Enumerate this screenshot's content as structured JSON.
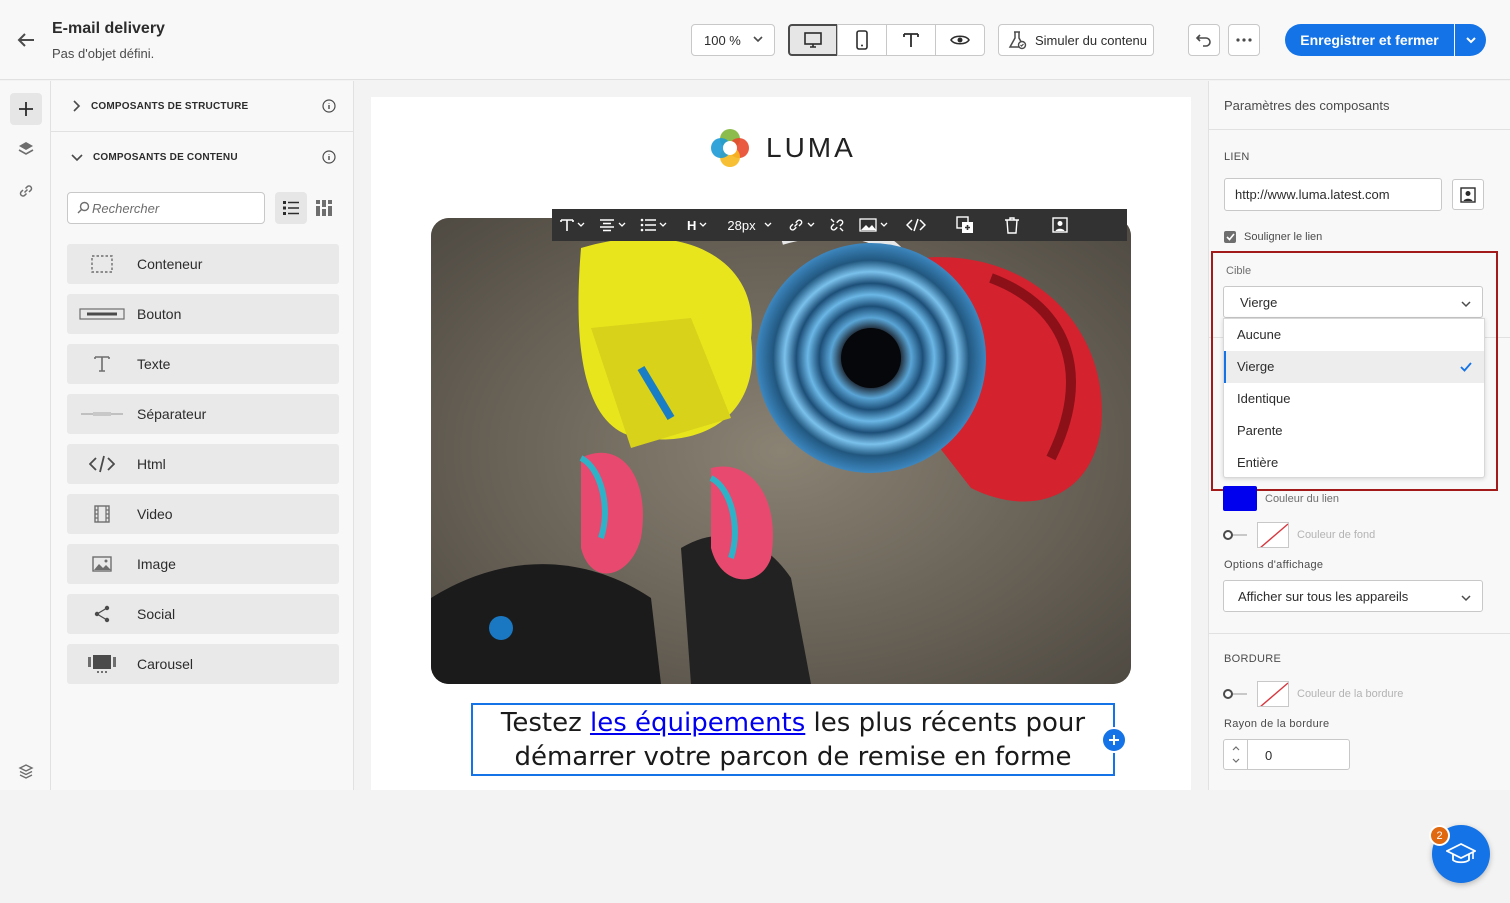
{
  "header": {
    "title": "E-mail delivery",
    "subtitle": "Pas d'objet défini.",
    "zoom": "100 %",
    "simulate_label": "Simuler du contenu",
    "save_label": "Enregistrer et fermer"
  },
  "left_panel": {
    "structure_header": "COMPOSANTS DE STRUCTURE",
    "content_header": "COMPOSANTS DE CONTENU",
    "search_placeholder": "Rechercher",
    "components": [
      {
        "label": "Conteneur",
        "icon": "container-icon"
      },
      {
        "label": "Bouton",
        "icon": "button-icon"
      },
      {
        "label": "Texte",
        "icon": "text-icon"
      },
      {
        "label": "Séparateur",
        "icon": "divider-icon"
      },
      {
        "label": "Html",
        "icon": "code-icon"
      },
      {
        "label": "Video",
        "icon": "film-icon"
      },
      {
        "label": "Image",
        "icon": "image-icon"
      },
      {
        "label": "Social",
        "icon": "share-icon"
      },
      {
        "label": "Carousel",
        "icon": "carousel-icon"
      }
    ]
  },
  "canvas": {
    "logo_text": "LUMA",
    "toolbar": {
      "heading": "H",
      "font_size": "28px"
    },
    "text_before": "Testez ",
    "link_text": "les équipements",
    "text_after_line1": " les plus récents pour",
    "text_line2": "démarrer votre parcon de remise en forme"
  },
  "right_panel": {
    "title": "Paramètres des composants",
    "link_section": "LIEN",
    "url": "http://www.luma.latest.com",
    "underline_label": "Souligner le lien",
    "target_label": "Cible",
    "target_selected": "Vierge",
    "target_options": [
      "Aucune",
      "Vierge",
      "Identique",
      "Parente",
      "Entière"
    ],
    "link_color_label": "Couleur du lien",
    "link_color": "#0000EE",
    "bg_color_label": "Couleur de fond",
    "display_options_label": "Options d'affichage",
    "display_selected": "Afficher sur tous les appareils",
    "border_section": "BORDURE",
    "border_color_label": "Couleur de la bordure",
    "border_radius_label": "Rayon de la bordure",
    "border_radius_value": "0"
  },
  "help": {
    "badge_count": "2"
  },
  "colors": {
    "accent": "#1473E6",
    "highlight": "#A31A1A",
    "badge": "#E0680F"
  }
}
